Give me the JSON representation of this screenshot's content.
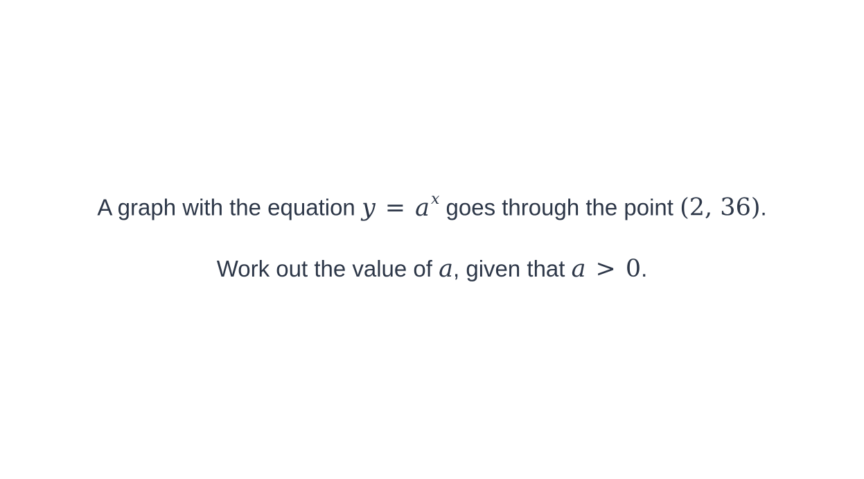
{
  "question": {
    "line1": {
      "text_before": "A graph with the equation ",
      "eq_lhs": "y",
      "eq_op": "=",
      "eq_base": "a",
      "eq_exponent": "x",
      "text_middle": " goes through the point ",
      "point": "(2, 36)",
      "text_end": "."
    },
    "line2": {
      "text_before": "Work out the value of ",
      "var": "a",
      "text_middle": ", given that ",
      "cond_var": "a",
      "cond_op": ">",
      "cond_value": "0",
      "text_end": "."
    }
  }
}
